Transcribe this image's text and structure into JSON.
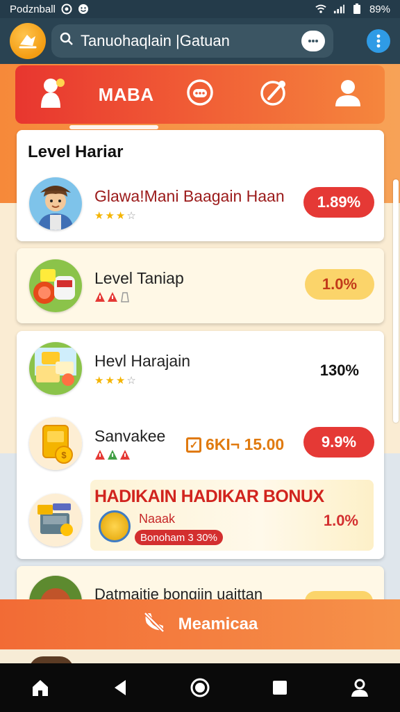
{
  "status_bar": {
    "carrier": "Podznball",
    "battery": "89%",
    "icons": [
      "record-icon",
      "emoji-icon",
      "wifi-icon",
      "signal-icon",
      "battery-icon"
    ]
  },
  "app_bar": {
    "search_placeholder": "Tanuohaqlain |Gatuan",
    "icons": [
      "app-logo-icon",
      "search-icon",
      "chat-icon",
      "more-icon"
    ]
  },
  "tabs": [
    {
      "label": "",
      "icon": "character-icon"
    },
    {
      "label": "MABA",
      "icon": ""
    },
    {
      "label": "",
      "icon": "controller-icon"
    },
    {
      "label": "",
      "icon": "edit-icon"
    },
    {
      "label": "",
      "icon": "profile-icon"
    }
  ],
  "section": {
    "title": "Level Hariar"
  },
  "rows": [
    {
      "title": "Glawa!Mani Baagain Haan",
      "value": "1.89%",
      "rating": "3 of 4 stars"
    },
    {
      "title": "Level Taniap",
      "value": "1.0%"
    },
    {
      "title": "Hevl Harajain",
      "value": "130%",
      "rating": "3 of 4 stars"
    },
    {
      "title": "Sanvakee",
      "coupon": "6KI¬ 15.00",
      "value": "9.9%"
    }
  ],
  "bonus": {
    "title": "HADIKAIN HADIKAR BONUX",
    "label": "Naaak",
    "value": "1.0%",
    "chip": "Bonoham 3 30%"
  },
  "partial_row": {
    "title": "Datmaitie bongiin uaittan"
  },
  "action_button": {
    "label": "Meamicaa",
    "icon": "phone-off-icon"
  },
  "nav": [
    "home-icon",
    "back-icon",
    "home-circle-icon",
    "recents-icon",
    "account-icon"
  ],
  "colors": {
    "accent_red": "#e53935",
    "accent_orange": "#f6893a",
    "gold": "#fbd46a",
    "dark_bar": "#2a4352"
  }
}
